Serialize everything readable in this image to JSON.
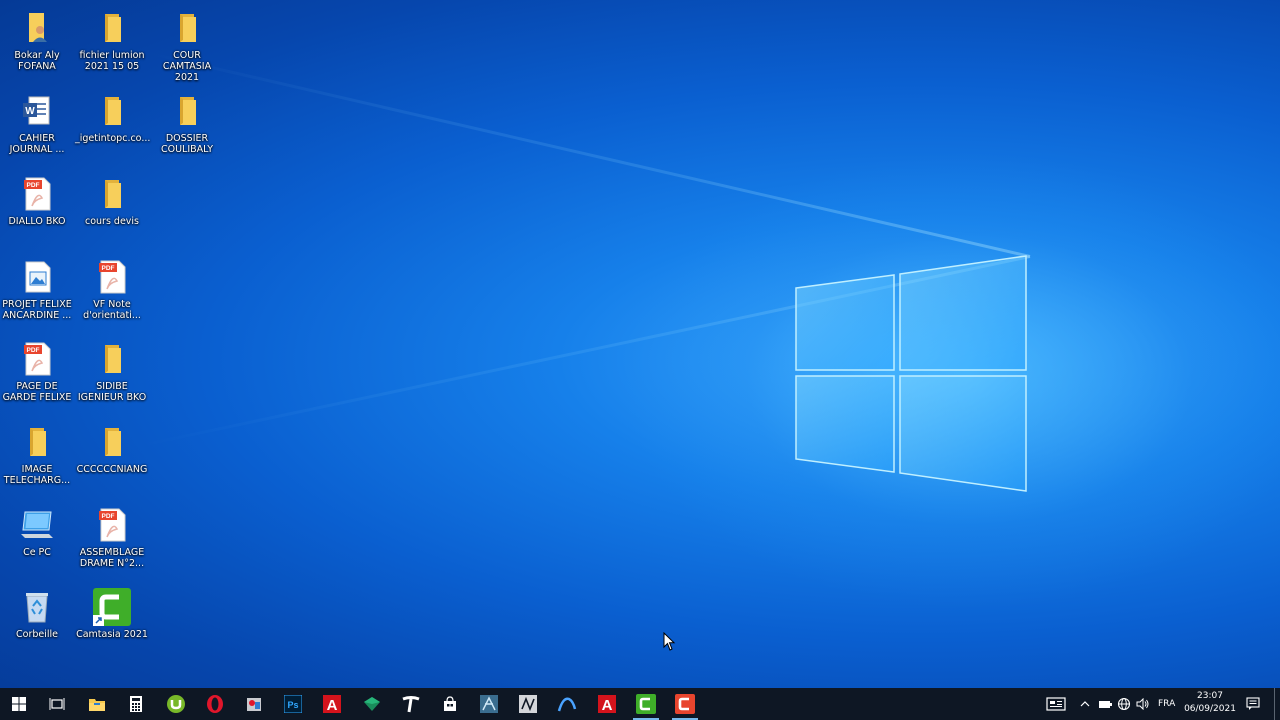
{
  "desktop": {
    "icons": [
      {
        "label": "Bokar Aly FOFANA",
        "type": "user-folder"
      },
      {
        "label": "fichier lumion 2021 15 05",
        "type": "folder"
      },
      {
        "label": "COUR CAMTASIA 2021",
        "type": "folder"
      },
      {
        "label": "CAHIER JOURNAL ...",
        "type": "word-document"
      },
      {
        "label": "_igetintopc.co...",
        "type": "folder"
      },
      {
        "label": "DOSSIER COULIBALY",
        "type": "folder"
      },
      {
        "label": "DIALLO BKO",
        "type": "pdf"
      },
      {
        "label": "cours devis",
        "type": "folder"
      },
      {
        "label": "PROJET FELIXE ANCARDINE ...",
        "type": "image"
      },
      {
        "label": "VF Note d'orientati...",
        "type": "pdf"
      },
      {
        "label": "PAGE DE GARDE FELIXE",
        "type": "pdf"
      },
      {
        "label": "SIDIBE IGENIEUR BKO",
        "type": "folder"
      },
      {
        "label": "IMAGE TELECHARG...",
        "type": "folder"
      },
      {
        "label": "CCCCCCNIANG",
        "type": "folder"
      },
      {
        "label": "Ce PC",
        "type": "computer"
      },
      {
        "label": "ASSEMBLAGE DRAME N°2...",
        "type": "pdf"
      },
      {
        "label": "Corbeille",
        "type": "recycle-bin"
      },
      {
        "label": "Camtasia 2021",
        "type": "camtasia-shortcut"
      }
    ]
  },
  "taskbar": {
    "apps": [
      {
        "name": "start-icon"
      },
      {
        "name": "task-view-icon"
      },
      {
        "name": "file-explorer-icon"
      },
      {
        "name": "calculator-icon"
      },
      {
        "name": "utorrent-icon"
      },
      {
        "name": "opera-icon"
      },
      {
        "name": "tools-icon"
      },
      {
        "name": "photoshop-icon",
        "text": "Ps"
      },
      {
        "name": "autocad-icon",
        "text": "A"
      },
      {
        "name": "sketchup-icon"
      },
      {
        "name": "typora-icon"
      },
      {
        "name": "store-icon"
      },
      {
        "name": "app-icon-1"
      },
      {
        "name": "app-icon-2"
      },
      {
        "name": "wave-app-icon"
      },
      {
        "name": "autocad-icon-2",
        "text": "A"
      },
      {
        "name": "camtasia-icon"
      },
      {
        "name": "camtasia-recorder-icon"
      }
    ],
    "tray": {
      "language": "FRA",
      "time": "23:07",
      "date": "06/09/2021"
    }
  },
  "colors": {
    "taskbar": "#0e1724",
    "folder": "#f7cf5b",
    "camtasia_green": "#3fae29",
    "camtasia_red": "#e8452e"
  }
}
